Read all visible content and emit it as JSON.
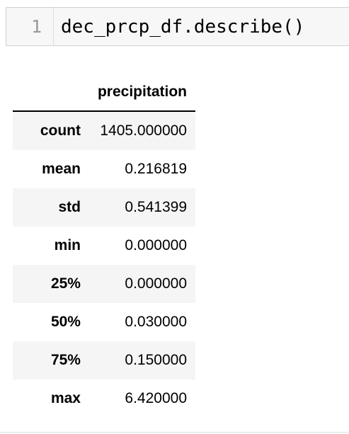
{
  "input_cell": {
    "line_number": "1",
    "code": "dec_prcp_df.describe()"
  },
  "output_table": {
    "columns": [
      "",
      "precipitation"
    ],
    "rows": [
      {
        "index": "count",
        "value": "1405.000000"
      },
      {
        "index": "mean",
        "value": "0.216819"
      },
      {
        "index": "std",
        "value": "0.541399"
      },
      {
        "index": "min",
        "value": "0.000000"
      },
      {
        "index": "25%",
        "value": "0.000000"
      },
      {
        "index": "50%",
        "value": "0.030000"
      },
      {
        "index": "75%",
        "value": "0.150000"
      },
      {
        "index": "max",
        "value": "6.420000"
      }
    ]
  }
}
